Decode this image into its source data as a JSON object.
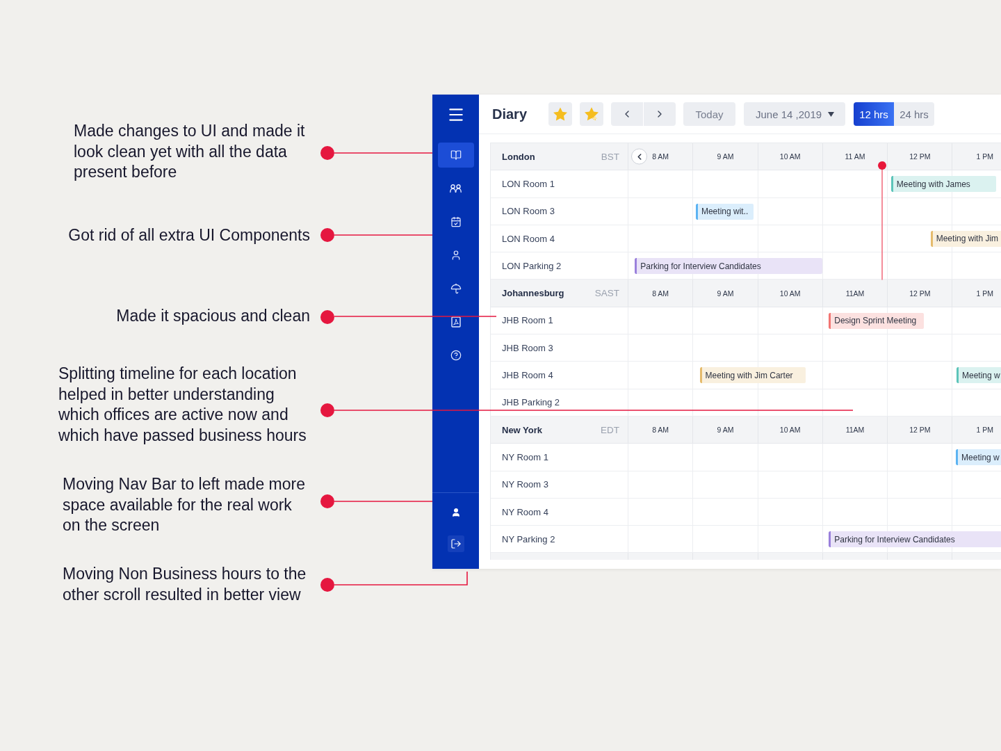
{
  "annotations": [
    {
      "text": "Made changes to UI and made it look clean yet with all the data present before"
    },
    {
      "text": "Got rid of all extra UI Components"
    },
    {
      "text": "Made it spacious and clean"
    },
    {
      "text": "Splitting timeline for each location helped in better understanding which offices are active now and which have passed business hours"
    },
    {
      "text": "Moving Nav Bar to left made more space available for the real work on the screen"
    },
    {
      "text": "Moving Non Business hours to the other scroll resulted in better view"
    }
  ],
  "nav": {
    "items": [
      {
        "selected": true
      },
      {
        "selected": false
      },
      {
        "selected": false
      },
      {
        "selected": false
      },
      {
        "selected": false
      },
      {
        "selected": false
      },
      {
        "selected": false
      }
    ],
    "bottom_items": [
      {
        "highlighted": false
      },
      {
        "highlighted": true
      }
    ]
  },
  "header": {
    "title": "Diary",
    "today": "Today",
    "date": "June 14 ,2019",
    "ranges": [
      {
        "label": "12 hrs",
        "selected": true
      },
      {
        "label": "24 hrs",
        "selected": false
      }
    ]
  },
  "sections": [
    {
      "city": "London",
      "timezone": "BST",
      "scroll_back_button": true,
      "now_line": true,
      "hours": [
        "8 AM",
        "9 AM",
        "10 AM",
        "11 AM",
        "12 PM",
        "1 PM"
      ],
      "rooms": [
        {
          "name": "LON Room 1",
          "events": [
            {
              "title": "Meeting with James",
              "color": "#5cc4b9"
            }
          ]
        },
        {
          "name": "LON Room 3",
          "events": [
            {
              "title": "Meeting wit..",
              "color": "#5cb3f2"
            }
          ]
        },
        {
          "name": "LON Room 4",
          "events": [
            {
              "title": "Meeting with Jim",
              "color": "#e5bb6c"
            }
          ]
        },
        {
          "name": "LON Parking 2",
          "events": [
            {
              "title": "Parking for Interview Candidates",
              "color": "#9a80dc"
            }
          ]
        }
      ]
    },
    {
      "city": "Johannesburg",
      "timezone": "SAST",
      "hours": [
        "8 AM",
        "9 AM",
        "10 AM",
        "11AM",
        "12 PM",
        "1 PM"
      ],
      "rooms": [
        {
          "name": "JHB Room 1",
          "events": [
            {
              "title": "Design Sprint Meeting",
              "color": "#f27573"
            }
          ]
        },
        {
          "name": "JHB Room 3"
        },
        {
          "name": "JHB Room 4",
          "events": [
            {
              "title": "Meeting with Jim Carter",
              "color": "#e5bb6c"
            },
            {
              "title": "Meeting w",
              "color": "#5cc4b9"
            }
          ]
        },
        {
          "name": "JHB Parking 2"
        }
      ]
    },
    {
      "city": "New York",
      "timezone": "EDT",
      "hours": [
        "8 AM",
        "9 AM",
        "10 AM",
        "11AM",
        "12 PM",
        "1 PM"
      ],
      "rooms": [
        {
          "name": "NY Room 1",
          "events": [
            {
              "title": "Meeting w",
              "color": "#5cb3f2"
            }
          ]
        },
        {
          "name": "NY Room 3"
        },
        {
          "name": "NY Room 4"
        },
        {
          "name": "NY Parking 2",
          "events": [
            {
              "title": "Parking for Interview Candidates",
              "color": "#9a80dc"
            }
          ]
        }
      ]
    }
  ]
}
